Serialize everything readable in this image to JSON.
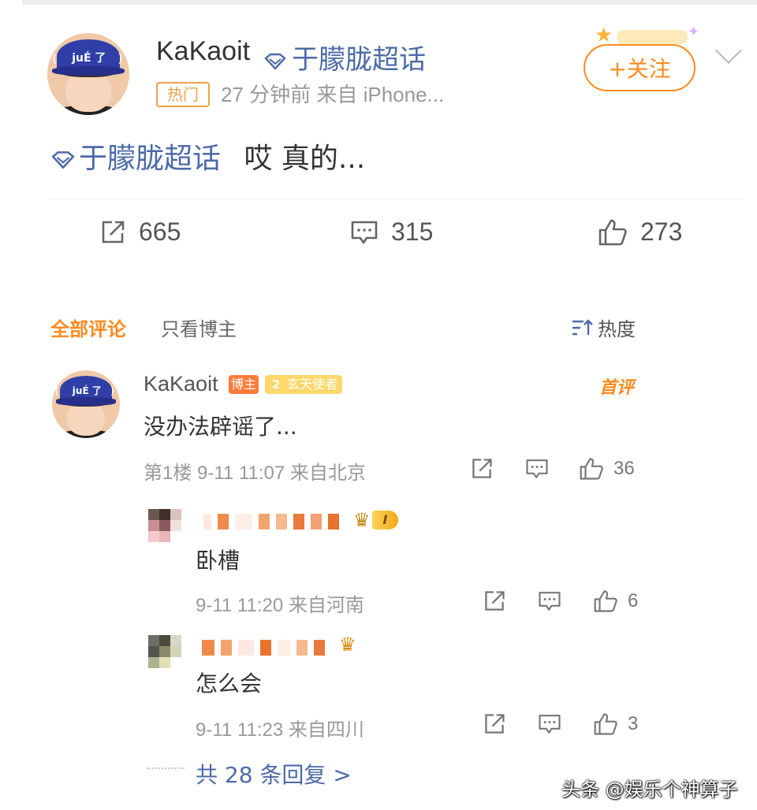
{
  "post": {
    "username": "KaKaoit",
    "topic": "于朦胧超话",
    "hot_badge": "热门",
    "meta": "27 分钟前   来自 iPhone...",
    "follow_label": "+关注",
    "text_topic": "于朦胧超话",
    "text_body": "哎 真的...",
    "stats": {
      "reposts": "665",
      "comments": "315",
      "likes": "273"
    }
  },
  "tabs": {
    "all": "全部评论",
    "op_only": "只看博主",
    "sort": "热度"
  },
  "comment": {
    "username": "KaKaoit",
    "badge_blogger": "博主",
    "badge_level": "2",
    "badge_title": "玄天使者",
    "top_label": "首评",
    "text": "没办法辟谣了...",
    "meta": "第1楼  9-11 11:07  来自北京",
    "likes": "36"
  },
  "replies": [
    {
      "level_badge": "I",
      "text": "卧槽",
      "meta": "9-11 11:20  来自河南",
      "likes": "6"
    },
    {
      "text": "怎么会",
      "meta": "9-11 11:23  来自四川",
      "likes": "3"
    }
  ],
  "more_replies": "共 28 条回复 >",
  "watermark": "头条 @娱乐个神算子",
  "colors": {
    "accent_orange": "#ff8a22",
    "link_blue": "#4b6aa8",
    "meta_gray": "#999999"
  }
}
